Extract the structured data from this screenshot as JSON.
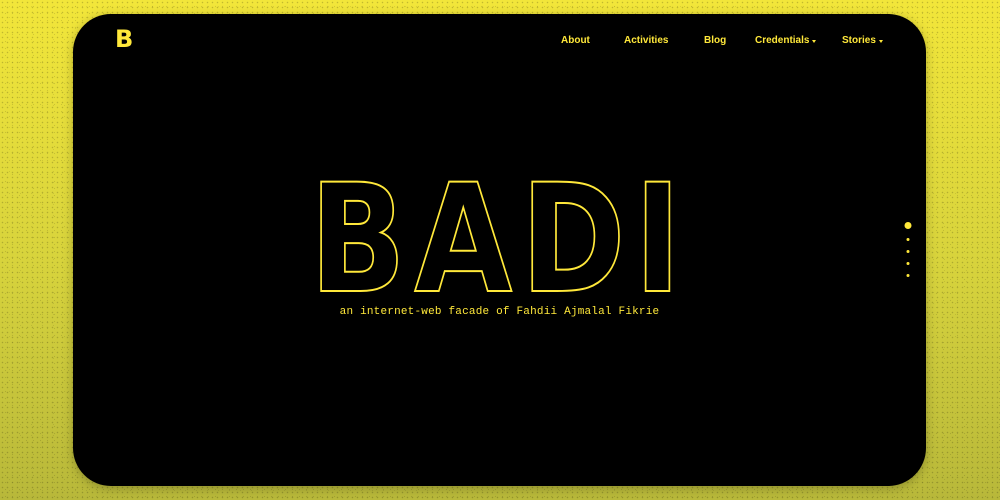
{
  "logo": {
    "text": "B"
  },
  "nav": {
    "items": [
      {
        "label": "About",
        "dropdown": false
      },
      {
        "label": "Activities",
        "dropdown": false
      },
      {
        "label": "Blog",
        "dropdown": false
      },
      {
        "label": "Credentials",
        "dropdown": true
      },
      {
        "label": "Stories",
        "dropdown": true
      }
    ]
  },
  "hero": {
    "title": "BADI",
    "subtitle": "an internet-web facade of Fahdii Ajmalal Fikrie"
  },
  "pagination": {
    "total": 5,
    "active_index": 0
  },
  "colors": {
    "accent": "#ffe83a",
    "background": "#000000",
    "page_background": "#e6dd3a"
  }
}
